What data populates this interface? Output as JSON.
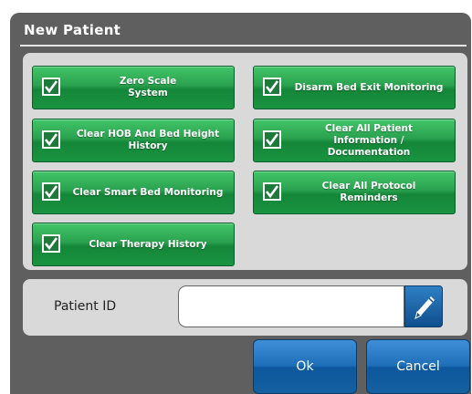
{
  "dialog": {
    "title": "New Patient"
  },
  "options": [
    {
      "id": "zero-scale",
      "label": "Zero Scale\nSystem",
      "checked": true
    },
    {
      "id": "disarm-bed-exit",
      "label": "Disarm Bed Exit Monitoring",
      "checked": true
    },
    {
      "id": "clear-hob",
      "label": "Clear HOB And Bed Height\nHistory",
      "checked": true
    },
    {
      "id": "clear-patient-info",
      "label": "Clear All Patient\nInformation /\nDocumentation",
      "checked": true
    },
    {
      "id": "clear-smart-bed",
      "label": "Clear Smart Bed Monitoring",
      "checked": true
    },
    {
      "id": "clear-protocol",
      "label": "Clear All Protocol\nReminders",
      "checked": true
    },
    {
      "id": "clear-therapy",
      "label": "Clear Therapy History",
      "checked": true
    }
  ],
  "patient_id": {
    "label": "Patient ID",
    "value": "",
    "edit_icon": "pencil-icon"
  },
  "buttons": {
    "ok": "Ok",
    "cancel": "Cancel"
  },
  "colors": {
    "dialog_bg": "#5f5f5f",
    "panel_bg": "#d9d9d9",
    "option_green": "#2aa14f",
    "button_blue": "#1e6fb8"
  }
}
